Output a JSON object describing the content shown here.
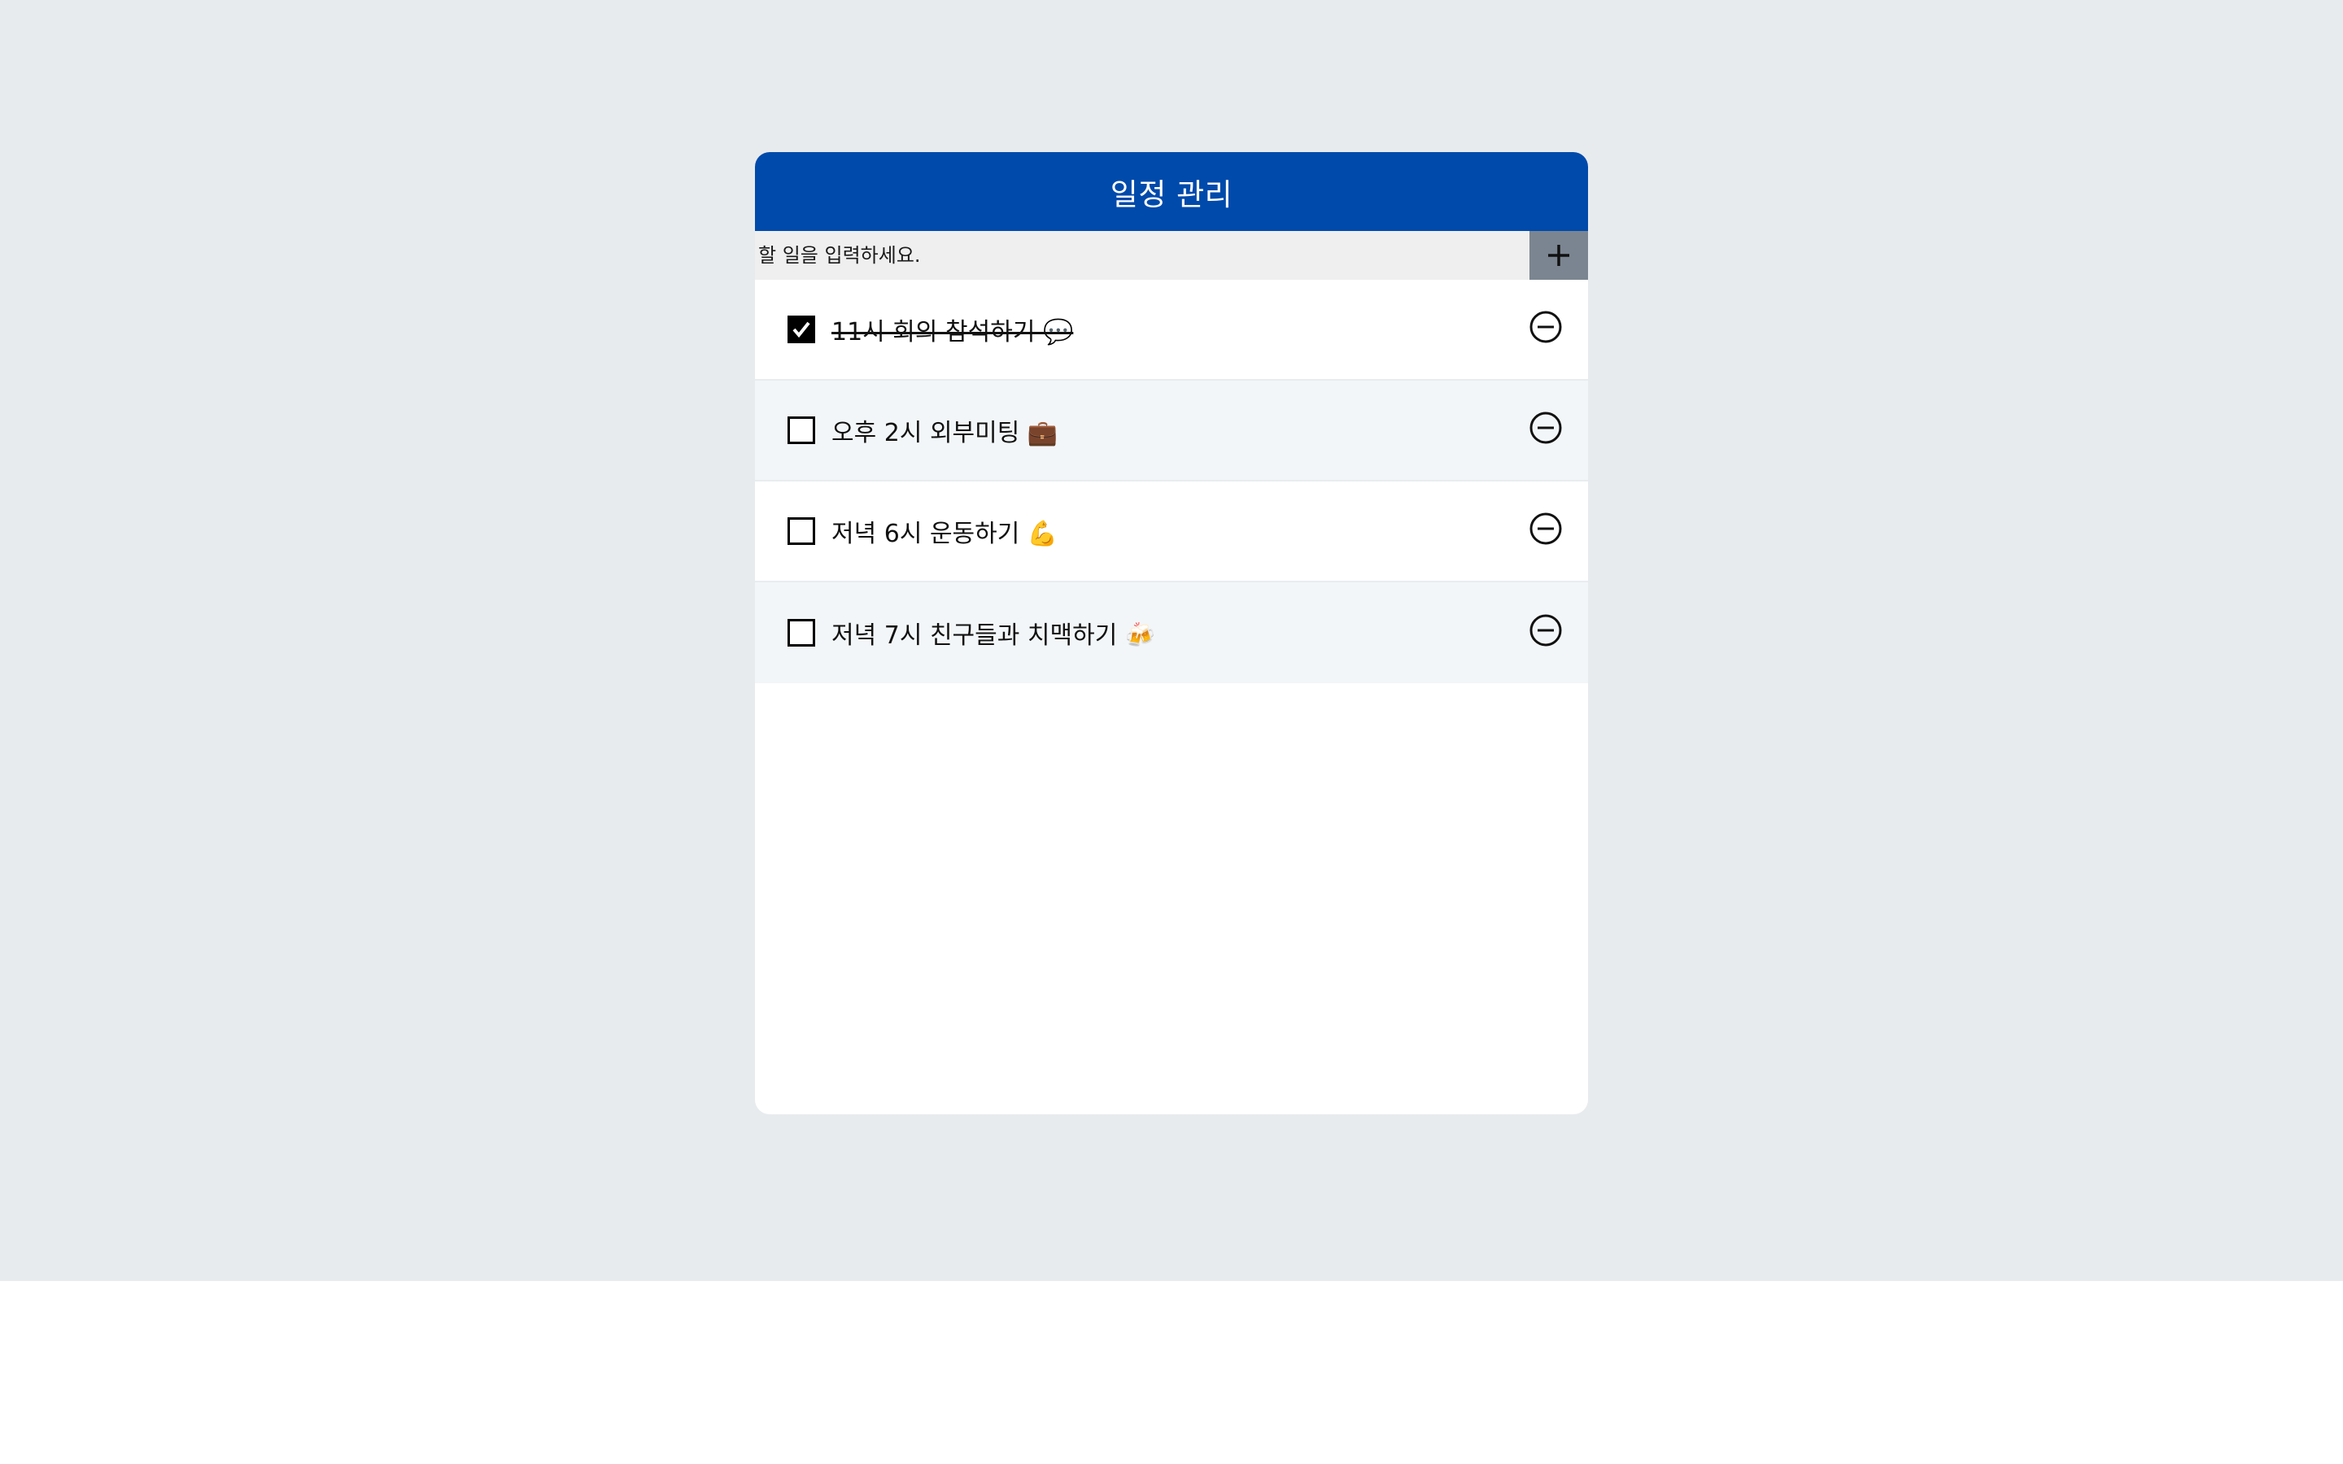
{
  "app": {
    "title": "일정 관리"
  },
  "input": {
    "placeholder": "할 일을 입력하세요.",
    "value": ""
  },
  "add_button": {
    "icon": "plus-icon"
  },
  "todos": [
    {
      "text": "11시 회의 참석하기 💬",
      "checked": true
    },
    {
      "text": "오후 2시 외부미팅 💼",
      "checked": false
    },
    {
      "text": "저녁 6시 운동하기 💪",
      "checked": false
    },
    {
      "text": "저녁 7시 친구들과 치맥하기 🍻",
      "checked": false
    }
  ],
  "colors": {
    "header": "#004aab",
    "background": "#e8ebee",
    "add_button": "#7b8591",
    "alt_row": "#f3f6f8"
  }
}
